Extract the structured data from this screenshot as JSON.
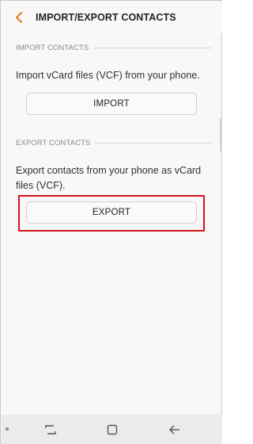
{
  "app_bar": {
    "title": "IMPORT/EXPORT CONTACTS",
    "back_icon": "chevron-left-icon",
    "accent_color": "#e07b1a"
  },
  "import_section": {
    "header": "IMPORT CONTACTS",
    "description": "Import vCard files (VCF) from your phone.",
    "button_label": "IMPORT"
  },
  "export_section": {
    "header": "EXPORT CONTACTS",
    "description": "Export contacts from your phone as vCard files (VCF).",
    "button_label": "EXPORT",
    "highlight_color": "#d6131b"
  },
  "nav_bar": {
    "icons": [
      "recent-apps-icon",
      "home-icon",
      "back-arrow-icon"
    ]
  }
}
